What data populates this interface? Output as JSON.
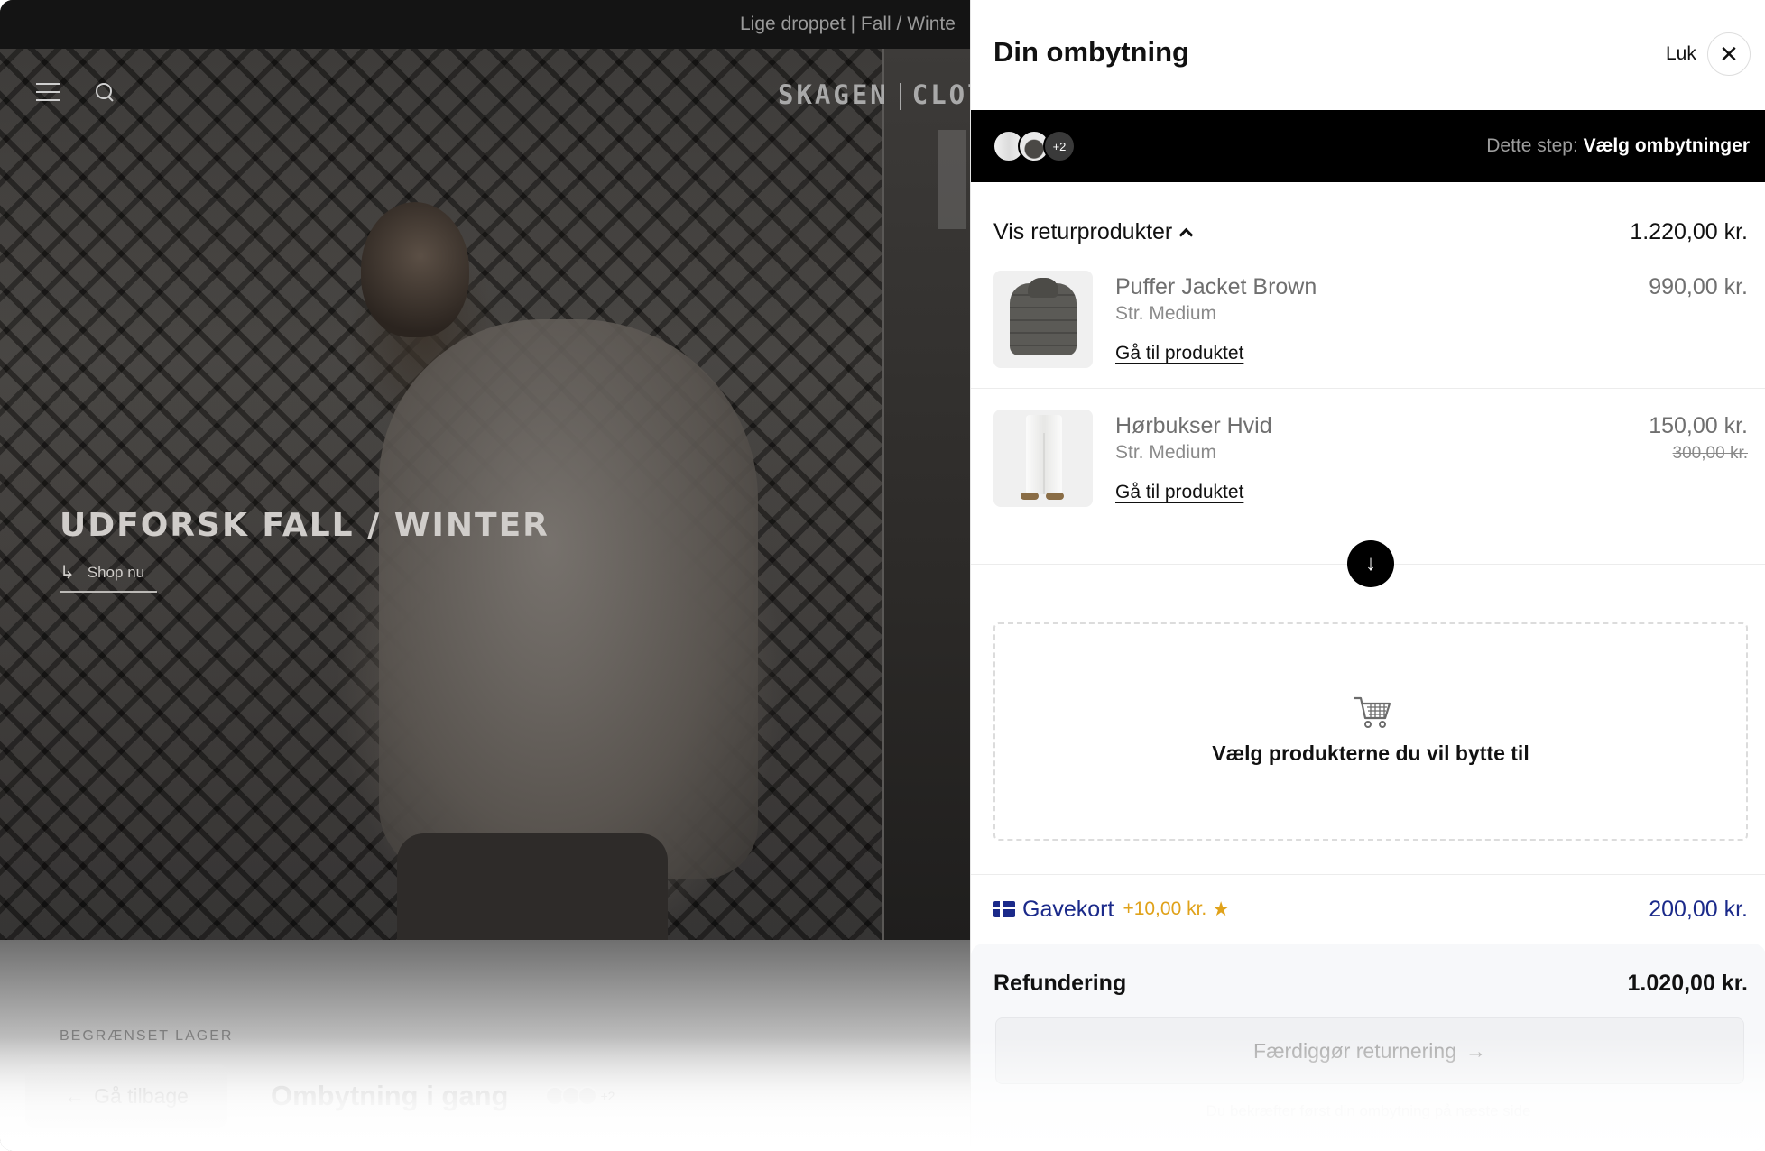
{
  "store": {
    "announcement": "Lige droppet | Fall / Winte",
    "logo": "SKAGEN CLOTH",
    "logo_left": "SKAGEN",
    "logo_right": "CLOTH",
    "hero_title": "UDFORSK FALL / WINTER",
    "hero_cta": "Shop nu",
    "bottom_label": "BEGRÆNSET LAGER",
    "back_button": "Gå tilbage",
    "bottom_title": "Ombytning i gang",
    "bottom_count": "+2"
  },
  "drawer": {
    "title": "Din ombytning",
    "close_label": "Luk",
    "stepbar": {
      "thumb_count": "+2",
      "step_label": "Dette step:",
      "step_value": "Vælg ombytninger"
    },
    "return_toggle": {
      "label": "Vis returprodukter",
      "total": "1.220,00 kr."
    },
    "products": [
      {
        "name": "Puffer Jacket Brown",
        "size": "Str. Medium",
        "link": "Gå til produktet",
        "price": "990,00 kr.",
        "old_price": ""
      },
      {
        "name": "Hørbukser Hvid",
        "size": "Str. Medium",
        "link": "Gå til produktet",
        "price": "150,00 kr.",
        "old_price": "300,00 kr."
      }
    ],
    "pick_label": "Vælg produkterne du vil bytte til",
    "giftcard": {
      "label": "Gavekort",
      "bonus": "+10,00 kr.",
      "amount": "200,00 kr."
    },
    "refund": {
      "label": "Refundering",
      "amount": "1.020,00 kr."
    },
    "finish_button": "Færdiggør returnering",
    "footnote": "Du bekræfter først din ombytning på næste side"
  },
  "colors": {
    "accent_navy": "#1b2a8a",
    "bonus_gold": "#e0a21a",
    "step_bar": "#000000"
  },
  "icons": {
    "menu": "hamburger-icon",
    "search": "search-icon",
    "close": "close-icon",
    "chevron": "chevron-up-icon",
    "swap": "arrow-down-icon",
    "cart": "cart-icon",
    "giftcard": "giftcard-icon",
    "star": "star-icon",
    "arrow_right": "arrow-right-icon",
    "arrow_left": "arrow-left-icon"
  }
}
